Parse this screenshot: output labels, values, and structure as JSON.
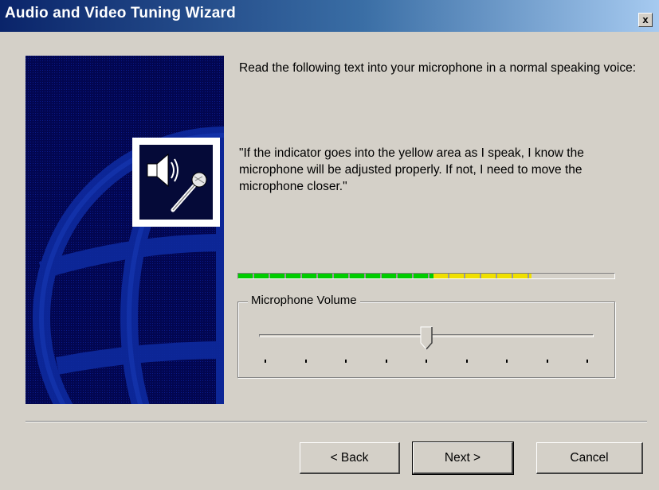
{
  "window": {
    "title": "Audio and Video Tuning Wizard",
    "close_label": "x"
  },
  "content": {
    "instruction": "Read the following text into your microphone in a normal speaking voice:",
    "quote": "\"If the indicator goes into the yellow area as I speak, I know the microphone will be adjusted properly. If not, I need to move the microphone closer.\""
  },
  "level_meter": {
    "green_fraction": 0.52,
    "yellow_fraction": 0.26,
    "green_color": "#00cc00",
    "yellow_color": "#f0e000"
  },
  "microphone_volume": {
    "label": "Microphone Volume",
    "value": 0.5,
    "tick_count": 9
  },
  "buttons": {
    "back": "< Back",
    "next": "Next >",
    "cancel": "Cancel"
  },
  "colors": {
    "title_bar": "#0a246a",
    "panel_bg": "#020650",
    "dialog_bg": "#d4d0c8"
  },
  "icons": {
    "wizard": "speaker-microphone-icon",
    "panel_art": "globe-icon"
  }
}
